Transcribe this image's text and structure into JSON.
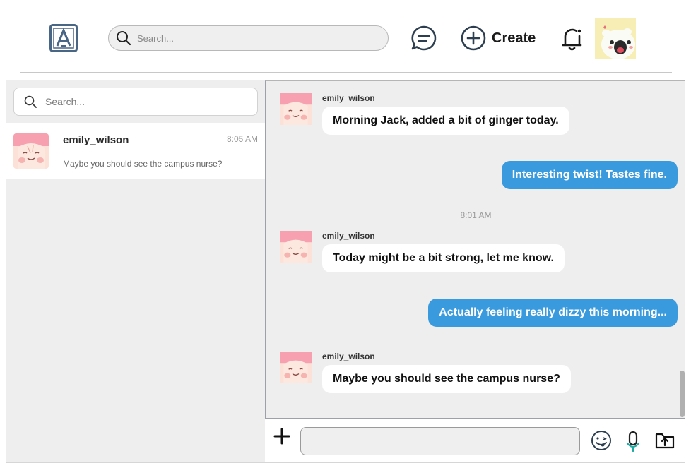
{
  "header": {
    "search_placeholder": "Search...",
    "create_label": "Create"
  },
  "sidebar": {
    "search_placeholder": "Search...",
    "conversations": [
      {
        "name": "emily_wilson",
        "time": "8:05 AM",
        "preview": "Maybe you should see the campus nurse?"
      }
    ]
  },
  "chat": {
    "messages": [
      {
        "direction": "incoming",
        "sender": "emily_wilson",
        "text": "Morning Jack, added a bit of ginger today."
      },
      {
        "direction": "outgoing",
        "text": "Interesting twist! Tastes fine."
      },
      {
        "direction": "separator",
        "text": "8:01 AM"
      },
      {
        "direction": "incoming",
        "sender": "emily_wilson",
        "text": "Today might be a bit strong, let me know."
      },
      {
        "direction": "outgoing",
        "text": "Actually feeling really dizzy this morning..."
      },
      {
        "direction": "incoming",
        "sender": "emily_wilson",
        "text": "Maybe you should see the campus nurse?"
      }
    ]
  },
  "composer": {
    "value": ""
  },
  "icons": {
    "logo": "app-logo-icon",
    "search": "search-icon",
    "chat": "chat-bubble-icon",
    "create": "plus-circle-icon",
    "notifications": "bell-icon",
    "add": "plus-icon",
    "emoji": "emoji-icon",
    "mic": "microphone-icon",
    "upload": "upload-icon"
  },
  "colors": {
    "accent": "#3a9ade",
    "panel": "#eeeeee",
    "logo": "#4a6685"
  }
}
